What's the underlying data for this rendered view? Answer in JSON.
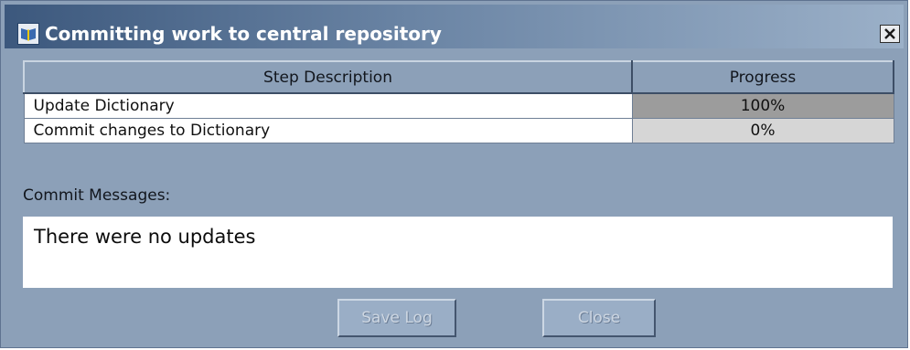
{
  "window": {
    "title": "Committing work to central repository",
    "icon": "open-book-icon",
    "close_icon": "close-icon"
  },
  "table": {
    "headers": [
      "Step Description",
      "Progress"
    ],
    "rows": [
      {
        "description": "Update Dictionary",
        "progress_label": "100%",
        "progress": 1.0
      },
      {
        "description": "Commit changes to Dictionary",
        "progress_label": "0%",
        "progress": 0.0
      }
    ]
  },
  "messages": {
    "label": "Commit Messages:",
    "text": "There were no updates"
  },
  "buttons": {
    "save_log": "Save Log",
    "close": "Close",
    "enabled": false
  },
  "colors": {
    "window_bg": "#8ca0b8",
    "progress_fill": "#9c9c9c",
    "progress_track": "#d6d6d6"
  }
}
